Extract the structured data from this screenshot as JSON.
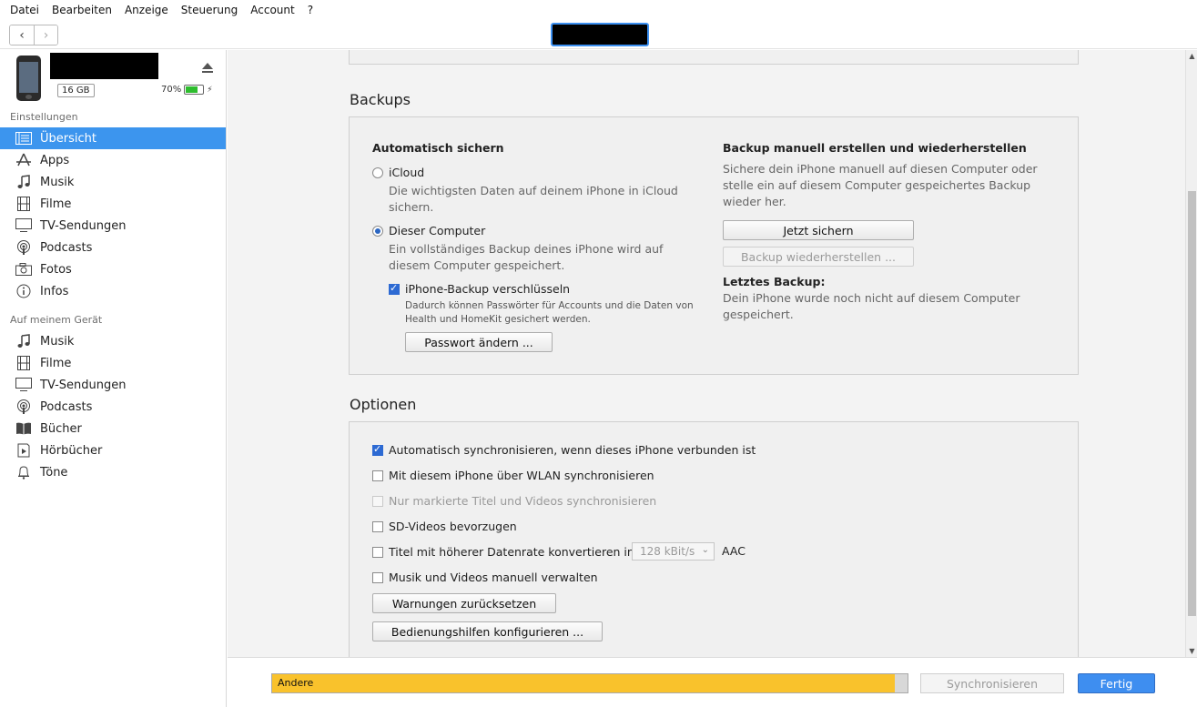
{
  "menu": [
    "Datei",
    "Bearbeiten",
    "Anzeige",
    "Steuerung",
    "Account",
    "?"
  ],
  "toolbar": {
    "back": "‹",
    "forward": "›"
  },
  "device": {
    "capacity": "16 GB",
    "battery": "70%",
    "battery_fraction": 0.7,
    "battery_color": "#2ebd2e"
  },
  "sidebar": {
    "settings_header": "Einstellungen",
    "settings": [
      {
        "label": "Übersicht",
        "icon": "summary-icon"
      },
      {
        "label": "Apps",
        "icon": "apps-icon"
      },
      {
        "label": "Musik",
        "icon": "music-icon"
      },
      {
        "label": "Filme",
        "icon": "film-icon"
      },
      {
        "label": "TV-Sendungen",
        "icon": "tv-icon"
      },
      {
        "label": "Podcasts",
        "icon": "podcast-icon"
      },
      {
        "label": "Fotos",
        "icon": "camera-icon"
      },
      {
        "label": "Infos",
        "icon": "info-icon"
      }
    ],
    "device_header": "Auf meinem Gerät",
    "ondevice": [
      {
        "label": "Musik",
        "icon": "music-icon"
      },
      {
        "label": "Filme",
        "icon": "film-icon"
      },
      {
        "label": "TV-Sendungen",
        "icon": "tv-icon"
      },
      {
        "label": "Podcasts",
        "icon": "podcast-icon"
      },
      {
        "label": "Bücher",
        "icon": "book-icon"
      },
      {
        "label": "Hörbücher",
        "icon": "audiobook-icon"
      },
      {
        "label": "Töne",
        "icon": "bell-icon"
      }
    ],
    "selected_color": "#3c95ee"
  },
  "backups": {
    "title": "Backups",
    "auto_title": "Automatisch sichern",
    "icloud_label": "iCloud",
    "icloud_desc": "Die wichtigsten Daten auf deinem iPhone in iCloud sichern.",
    "computer_label": "Dieser Computer",
    "computer_desc": "Ein vollständiges Backup deines iPhone wird auf diesem Computer gespeichert.",
    "encrypt_label": "iPhone-Backup verschlüsseln",
    "encrypt_desc": "Dadurch können Passwörter für Accounts und die Daten von Health und HomeKit gesichert werden.",
    "change_pw": "Passwort ändern ...",
    "manual_title": "Backup manuell erstellen und wiederherstellen",
    "manual_desc": "Sichere dein iPhone manuell auf diesen Computer oder stelle ein auf diesem Computer gespeichertes Backup wieder her.",
    "backup_now": "Jetzt sichern",
    "restore": "Backup wiederherstellen ...",
    "last_title": "Letztes Backup:",
    "last_desc": "Dein iPhone wurde noch nicht auf diesem Computer gespeichert."
  },
  "options": {
    "title": "Optionen",
    "auto_sync": "Automatisch synchronisieren, wenn dieses iPhone verbunden ist",
    "wlan_sync": "Mit diesem iPhone über WLAN synchronisieren",
    "marked_only": "Nur markierte Titel und Videos synchronisieren",
    "sd_video": "SD-Videos bevorzugen",
    "convert": "Titel mit höherer Datenrate konvertieren in",
    "bitrate": "128 kBit/s",
    "codec": "AAC",
    "manual": "Musik und Videos manuell verwalten",
    "reset_warn": "Warnungen zurücksetzen",
    "accessibility": "Bedienungshilfen konfigurieren ..."
  },
  "bottom": {
    "storage_label": "Andere",
    "storage_fraction": 0.98,
    "storage_color": "#f9c22c",
    "sync": "Synchronisieren",
    "done": "Fertig"
  }
}
